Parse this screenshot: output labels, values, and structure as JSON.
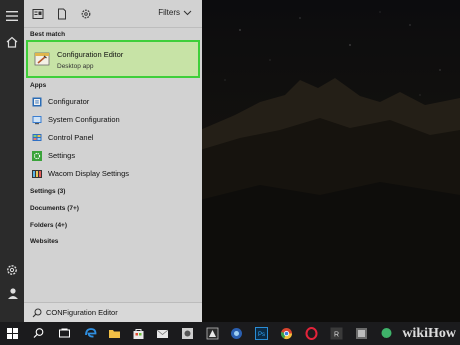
{
  "toolbar": {
    "filters_label": "Filters",
    "icons": [
      "apps-icon",
      "document-icon",
      "gear-icon"
    ]
  },
  "sections": {
    "best_match": "Best match",
    "apps": "Apps"
  },
  "best_match": {
    "title": "Configuration Editor",
    "subtitle": "Desktop app",
    "icon": "configuration-editor-icon"
  },
  "apps": [
    {
      "label": "Configurator",
      "icon": "configurator-icon"
    },
    {
      "label": "System Configuration",
      "icon": "system-configuration-icon"
    },
    {
      "label": "Control Panel",
      "icon": "control-panel-icon"
    },
    {
      "label": "Settings",
      "icon": "settings-icon"
    },
    {
      "label": "Wacom Display Settings",
      "icon": "wacom-icon"
    }
  ],
  "categories": [
    {
      "label": "Settings (3)"
    },
    {
      "label": "Documents (7+)"
    },
    {
      "label": "Folders (4+)"
    },
    {
      "label": "Websites"
    }
  ],
  "search": {
    "text": "CONFiguration Editor"
  },
  "brand": "wikiHow",
  "colors": {
    "menu_bg": "#d2d2d2",
    "highlight_bg": "#c7e3a6",
    "highlight_border": "#3fcf3a",
    "rail_bg": "#2b2b2b",
    "taskbar_bg": "#1b1b1d"
  }
}
